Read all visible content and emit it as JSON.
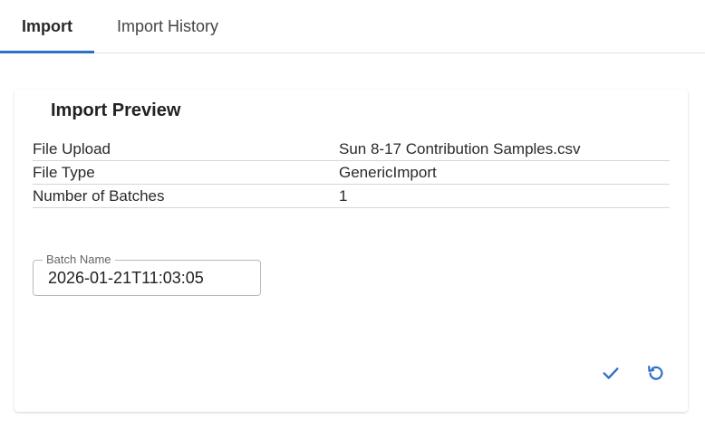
{
  "tabs": [
    {
      "label": "Import",
      "active": true
    },
    {
      "label": "Import History",
      "active": false
    }
  ],
  "preview": {
    "title": "Import Preview",
    "rows": [
      {
        "key": "File Upload",
        "value": "Sun 8-17 Contribution Samples.csv"
      },
      {
        "key": "File Type",
        "value": "GenericImport"
      },
      {
        "key": "Number of Batches",
        "value": "1"
      }
    ],
    "batch_name": {
      "label": "Batch Name",
      "value": "2026-01-21T11:03:05"
    }
  },
  "actions": {
    "confirm_icon": "check-icon",
    "reset_icon": "undo-icon"
  },
  "colors": {
    "accent": "#2f6fca",
    "icon": "#2f6fca"
  }
}
